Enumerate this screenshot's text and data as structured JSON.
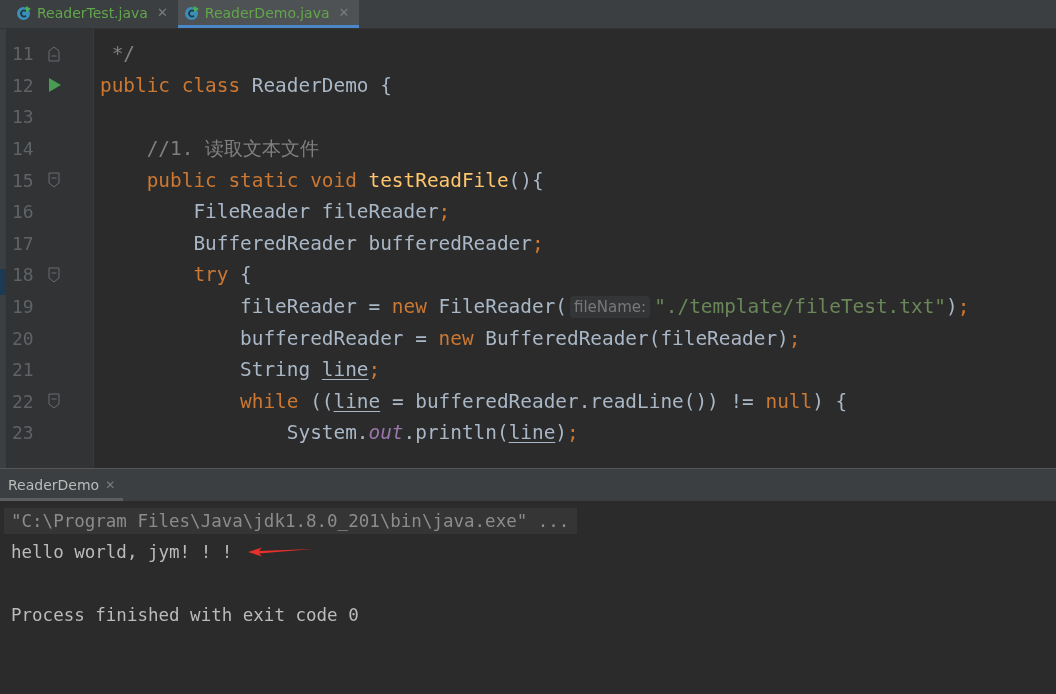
{
  "tabs": [
    {
      "label": "ReaderTest.java",
      "close": "✕",
      "selected": false
    },
    {
      "label": "ReaderDemo.java",
      "close": "✕",
      "selected": true
    }
  ],
  "editor": {
    "lines": [
      {
        "number": "11",
        "marker": {
          "kind": "fold_end"
        },
        "tokens": [
          {
            "text": " */",
            "kind": "comment"
          }
        ]
      },
      {
        "number": "12",
        "marker": {
          "kind": "run"
        },
        "tokens": [
          {
            "text": "public class ",
            "kind": "keyword"
          },
          {
            "text": "ReaderDemo {",
            "kind": "plain"
          }
        ]
      },
      {
        "number": "13"
      },
      {
        "number": "14",
        "tokens": [
          {
            "text": "    //1. 读取文本文件",
            "kind": "comment"
          }
        ]
      },
      {
        "number": "15",
        "marker": {
          "kind": "fold_start"
        },
        "tokens": [
          {
            "text": "    public static void ",
            "kind": "keyword"
          },
          {
            "text": "testReadFile",
            "kind": "method"
          },
          {
            "text": "(){",
            "kind": "plain"
          }
        ]
      },
      {
        "number": "16",
        "tokens": [
          {
            "text": "        FileReader fileReader",
            "kind": "plain"
          },
          {
            "text": ";",
            "kind": "keyword"
          }
        ]
      },
      {
        "number": "17",
        "tokens": [
          {
            "text": "        BufferedReader bufferedReader",
            "kind": "plain"
          },
          {
            "text": ";",
            "kind": "keyword"
          }
        ]
      },
      {
        "number": "18",
        "marker": {
          "kind": "fold_start"
        },
        "tokens": [
          {
            "text": "        try ",
            "kind": "keyword"
          },
          {
            "text": "{",
            "kind": "plain"
          }
        ]
      },
      {
        "number": "19",
        "tokens": [
          {
            "text": "            fileReader = ",
            "kind": "plain"
          },
          {
            "text": "new ",
            "kind": "keyword"
          },
          {
            "text": "FileReader(",
            "kind": "plain"
          },
          {
            "text": "fileName:",
            "kind": "hint"
          },
          {
            "text": "\"./template/fileTest.txt\"",
            "kind": "string"
          },
          {
            "text": ")",
            "kind": "plain"
          },
          {
            "text": ";",
            "kind": "keyword"
          }
        ]
      },
      {
        "number": "20",
        "tokens": [
          {
            "text": "            bufferedReader = ",
            "kind": "plain"
          },
          {
            "text": "new ",
            "kind": "keyword"
          },
          {
            "text": "BufferedReader(fileReader)",
            "kind": "plain"
          },
          {
            "text": ";",
            "kind": "keyword"
          }
        ]
      },
      {
        "number": "21",
        "tokens": [
          {
            "text": "            String ",
            "kind": "plain"
          },
          {
            "text": "line",
            "kind": "variable"
          },
          {
            "text": ";",
            "kind": "keyword"
          }
        ]
      },
      {
        "number": "22",
        "marker": {
          "kind": "fold_start"
        },
        "tokens": [
          {
            "text": "            while ",
            "kind": "keyword"
          },
          {
            "text": "((",
            "kind": "plain"
          },
          {
            "text": "line",
            "kind": "variable"
          },
          {
            "text": " = bufferedReader.readLine()) != ",
            "kind": "plain"
          },
          {
            "text": "null",
            "kind": "keyword"
          },
          {
            "text": ") {",
            "kind": "plain"
          }
        ]
      },
      {
        "number": "23",
        "tokens": [
          {
            "text": "                System.",
            "kind": "plain"
          },
          {
            "text": "out",
            "kind": "field"
          },
          {
            "text": ".println(",
            "kind": "plain"
          },
          {
            "text": "line",
            "kind": "variable"
          },
          {
            "text": ")",
            "kind": "plain"
          },
          {
            "text": ";",
            "kind": "keyword"
          }
        ]
      }
    ]
  },
  "console": {
    "tab": {
      "label": "ReaderDemo",
      "close": "✕",
      "selected": true
    },
    "lines": [
      {
        "text": "\"C:\\Program Files\\Java\\jdk1.8.0_201\\bin\\java.exe\" ...",
        "kind": "command"
      },
      {
        "text": "hello world, jym! ! !",
        "kind": "output"
      },
      {
        "text": "Process finished with exit code 0",
        "kind": "exit"
      }
    ]
  }
}
